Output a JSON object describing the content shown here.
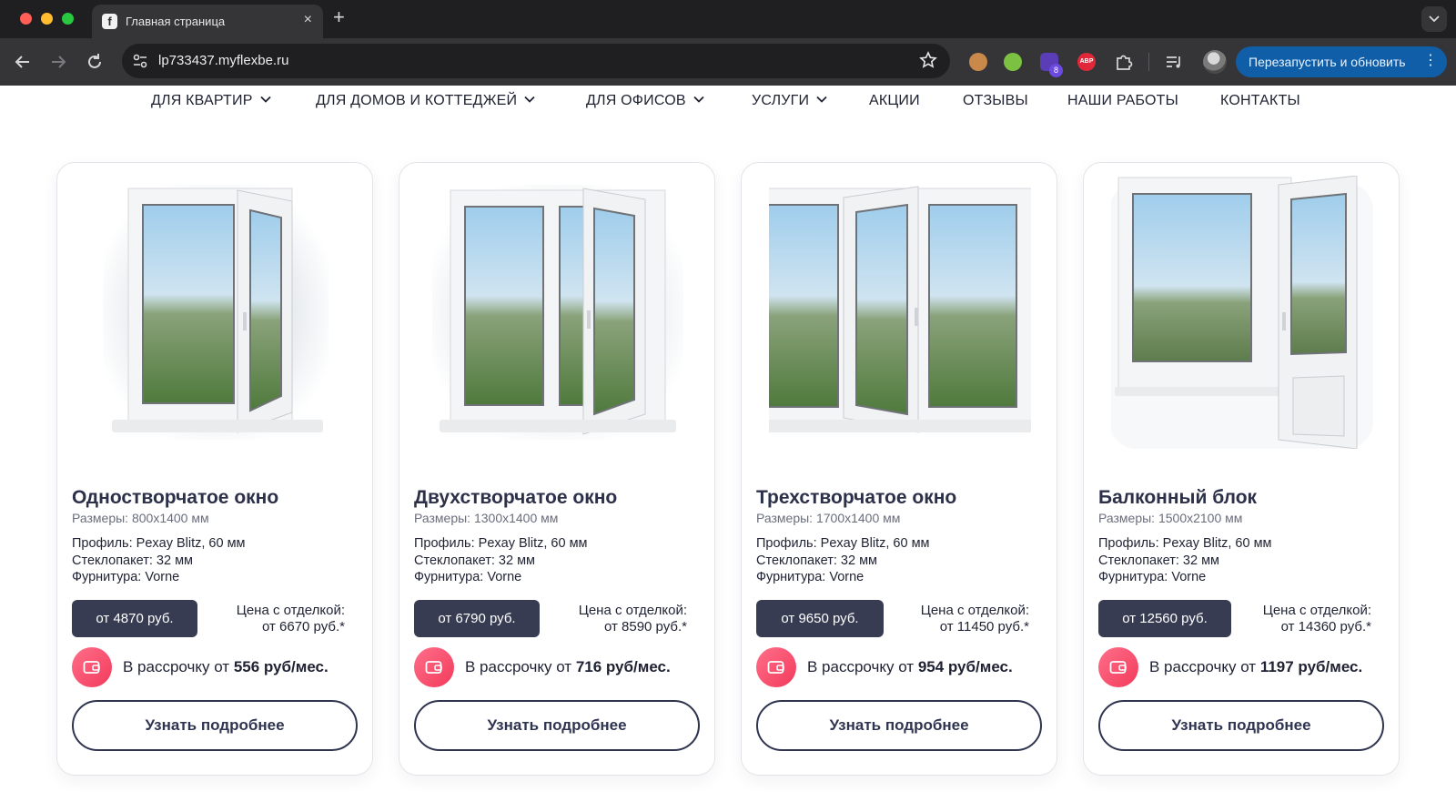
{
  "browser": {
    "tab_title": "Главная страница",
    "tab_favicon": "f",
    "url": "lp733437.myflexbe.ru",
    "ext_badge": "8",
    "ext_abp_label": "ABP",
    "update_button": "Перезапустить и обновить",
    "menu_dots": "⋮",
    "new_tab": "+",
    "close_tab": "×"
  },
  "nav": {
    "items": [
      {
        "label": "ДЛЯ КВАРТИР"
      },
      {
        "label": "ДЛЯ ДОМОВ И КОТТЕДЖЕЙ"
      },
      {
        "label": "ДЛЯ ОФИСОВ"
      },
      {
        "label": "УСЛУГИ"
      },
      {
        "label": "АКЦИИ"
      },
      {
        "label": "ОТЗЫВЫ"
      },
      {
        "label": "НАШИ РАБОТЫ"
      },
      {
        "label": "КОНТАКТЫ"
      }
    ]
  },
  "products": [
    {
      "title": "Одностворчатое окно",
      "size": "Размеры: 800x1400 мм",
      "profile": "Профиль: Pexay Blitz, 60 мм",
      "glass": "Стеклопакет: 32 мм",
      "hardware": "Фурнитура: Vorne",
      "price": "от 4870 руб.",
      "finish_label": "Цена с отделкой:",
      "finish_price": "от 6670 руб.*",
      "install_prefix": "В рассрочку от ",
      "install_amount": "556 руб/мес.",
      "more": "Узнать подробнее"
    },
    {
      "title": "Двухстворчатое окно",
      "size": "Размеры: 1300x1400 мм",
      "profile": "Профиль: Pexay Blitz, 60 мм",
      "glass": "Стеклопакет: 32 мм",
      "hardware": "Фурнитура: Vorne",
      "price": "от 6790 руб.",
      "finish_label": "Цена с отделкой:",
      "finish_price": "от 8590 руб.*",
      "install_prefix": "В рассрочку от ",
      "install_amount": "716 руб/мес.",
      "more": "Узнать подробнее"
    },
    {
      "title": "Трехстворчатое окно",
      "size": "Размеры: 1700x1400 мм",
      "profile": "Профиль: Pexay Blitz, 60 мм",
      "glass": "Стеклопакет: 32 мм",
      "hardware": "Фурнитура: Vorne",
      "price": "от 9650 руб.",
      "finish_label": "Цена с отделкой:",
      "finish_price": "от 11450 руб.*",
      "install_prefix": "В рассрочку от ",
      "install_amount": "954 руб/мес.",
      "more": "Узнать подробнее"
    },
    {
      "title": "Балконный блок",
      "size": "Размеры: 1500x2100 мм",
      "profile": "Профиль: Pexay Blitz, 60 мм",
      "glass": "Стеклопакет: 32 мм",
      "hardware": "Фурнитура: Vorne",
      "price": "от 12560 руб.",
      "finish_label": "Цена с отделкой:",
      "finish_price": "от 14360 руб.*",
      "install_prefix": "В рассрочку от ",
      "install_amount": "1197 руб/мес.",
      "more": "Узнать подробнее"
    }
  ],
  "colors": {
    "price_button": "#373c52",
    "title": "#2c3149",
    "wallet_gradient_start": "#ff6f8a",
    "wallet_gradient_end": "#f23b5b",
    "update_button": "#0f5ea7"
  }
}
